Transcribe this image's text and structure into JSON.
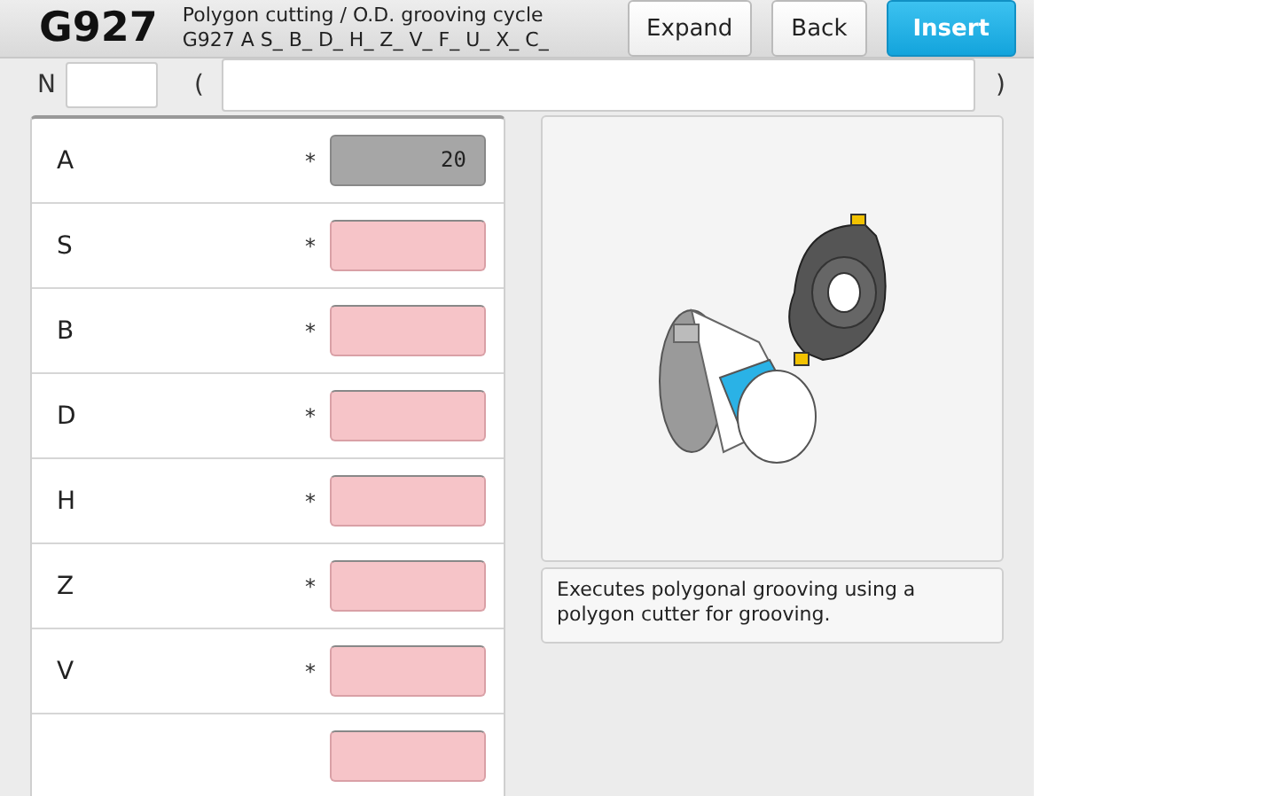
{
  "header": {
    "code": "G927",
    "title": "Polygon cutting / O.D. grooving cycle",
    "syntax": "G927 A S_ B_ D_ H_ Z_ V_ F_ U_ X_ C_",
    "buttons": [
      {
        "label": "Expand",
        "kind": "plain"
      },
      {
        "label": "Back",
        "kind": "plain"
      },
      {
        "label": "Insert",
        "kind": "primary"
      }
    ]
  },
  "block": {
    "n_label": "N",
    "open_paren": "(",
    "close_paren": ")"
  },
  "parameters": [
    {
      "label": "A",
      "mark": "*",
      "kind": "fixed",
      "value": "20"
    },
    {
      "label": "S",
      "mark": "*",
      "kind": "required"
    },
    {
      "label": "B",
      "mark": "*",
      "kind": "required"
    },
    {
      "label": "D",
      "mark": "*",
      "kind": "required"
    },
    {
      "label": "H",
      "mark": "*",
      "kind": "required"
    },
    {
      "label": "Z",
      "mark": "*",
      "kind": "required"
    },
    {
      "label": "V",
      "mark": "*",
      "kind": "required"
    },
    {
      "kind": "required"
    }
  ],
  "description": "Executes polygonal grooving using a polygon cutter for grooving."
}
